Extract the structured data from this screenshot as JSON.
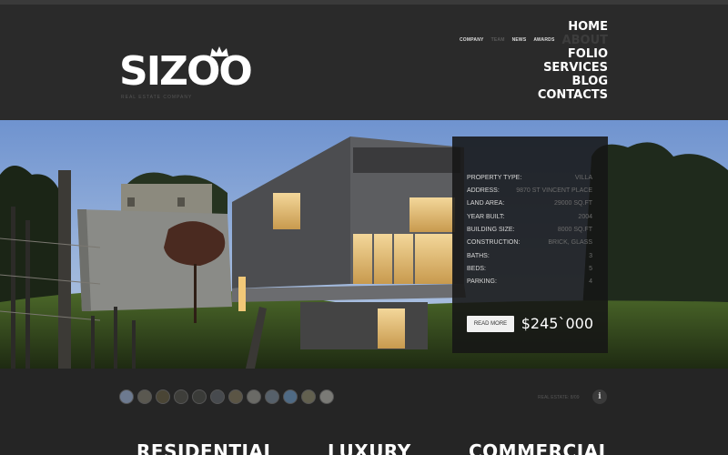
{
  "brand": {
    "name": "SIZOO",
    "tagline": "REAL ESTATE COMPANY"
  },
  "subnav": [
    {
      "label": "COMPANY",
      "active": true
    },
    {
      "label": "TEAM",
      "active": false
    },
    {
      "label": "NEWS",
      "active": true
    },
    {
      "label": "AWARDS",
      "active": true
    }
  ],
  "mainnav": [
    {
      "label": "HOME",
      "active": true
    },
    {
      "label": "ABOUT",
      "active": false
    },
    {
      "label": "FOLIO",
      "active": true
    },
    {
      "label": "SERVICES",
      "active": true
    },
    {
      "label": "BLOG",
      "active": true
    },
    {
      "label": "CONTACTS",
      "active": true
    }
  ],
  "property": {
    "rows": [
      {
        "key": "PROPERTY TYPE:",
        "value": "VILLA"
      },
      {
        "key": "ADDRESS:",
        "value": "9870 ST VINCENT PLACE"
      },
      {
        "key": "LAND AREA:",
        "value": "29000 SQ.FT"
      },
      {
        "key": "YEAR BUILT:",
        "value": "2004"
      },
      {
        "key": "BUILDING SIZE:",
        "value": "8000 SQ.FT"
      },
      {
        "key": "CONSTRUCTION:",
        "value": "BRICK, GLASS"
      },
      {
        "key": "BATHS:",
        "value": "3"
      },
      {
        "key": "BEDS:",
        "value": "5"
      },
      {
        "key": "PARKING:",
        "value": "4"
      }
    ],
    "read_more": "READ MORE",
    "price": "$245`000"
  },
  "slider": {
    "counter": "REAL ESTATE: 8/09",
    "info_icon": "i"
  },
  "categories": [
    "RESIDENTIAL",
    "LUXURY",
    "COMMERCIAL"
  ],
  "colors": {
    "background": "#252525",
    "header": "#2a2a2a",
    "panel": "#161616"
  }
}
